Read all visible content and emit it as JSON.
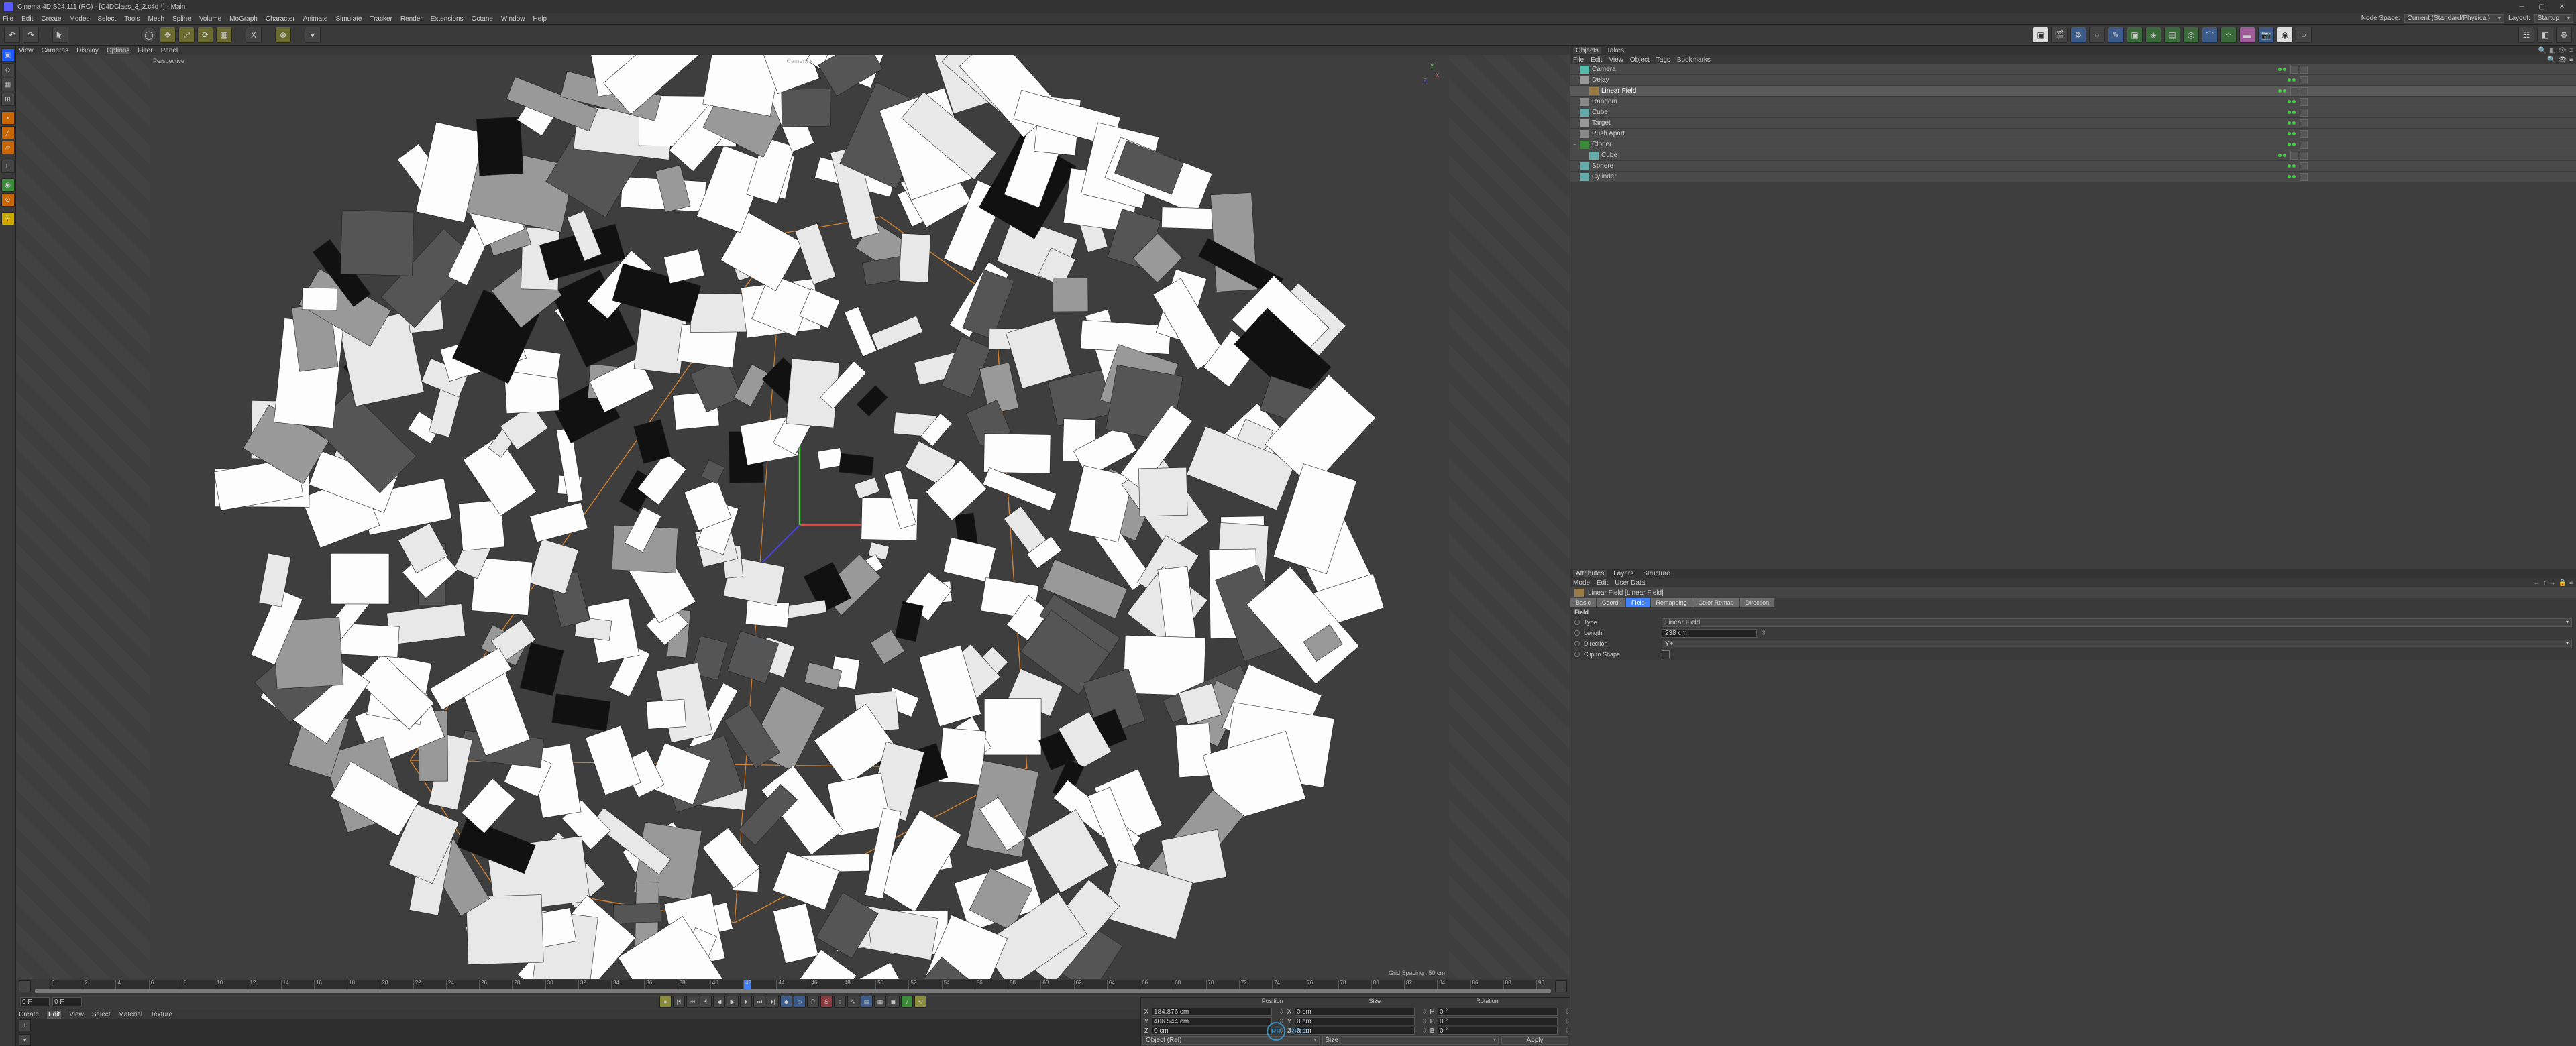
{
  "title": "Cinema 4D S24.111 (RC) - [C4DClass_3_2.c4d *] - Main",
  "menubar": [
    "File",
    "Edit",
    "Create",
    "Modes",
    "Select",
    "Tools",
    "Mesh",
    "Spline",
    "Volume",
    "MoGraph",
    "Character",
    "Animate",
    "Simulate",
    "Tracker",
    "Render",
    "Extensions",
    "Octane",
    "Window",
    "Help"
  ],
  "header_right": {
    "node_space_label": "Node Space:",
    "node_space_value": "Current (Standard/Physical)",
    "layout_label": "Layout:",
    "layout_value": "Startup"
  },
  "view_menu": [
    "View",
    "Cameras",
    "Display",
    "Options",
    "Filter",
    "Panel"
  ],
  "view_active_index": 3,
  "viewport": {
    "perspective": "Perspective",
    "camera": "Camera ▾",
    "grid": "Grid Spacing : 50 cm"
  },
  "timeline": {
    "start": "0 F",
    "end": "90 F",
    "range_start": "0 F",
    "range_end": "90 F",
    "cursor_frame": 42
  },
  "material_menu": [
    "Create",
    "Edit",
    "View",
    "Select",
    "Material",
    "Texture"
  ],
  "material_active_index": 1,
  "coords": {
    "headers": [
      "Position",
      "Size",
      "Rotation"
    ],
    "rows": [
      {
        "axis": "X",
        "pos": "184.876 cm",
        "size": "0 cm",
        "rotlbl": "H",
        "rot": "0 °"
      },
      {
        "axis": "Y",
        "pos": "406.544 cm",
        "size": "0 cm",
        "rotlbl": "P",
        "rot": "0 °"
      },
      {
        "axis": "Z",
        "pos": "0 cm",
        "size": "0 cm",
        "rotlbl": "B",
        "rot": "0 °"
      }
    ],
    "object_combo": "Object (Rel)",
    "size_combo": "Size",
    "apply": "Apply"
  },
  "objects_panel": {
    "tabs": [
      "Objects",
      "Takes"
    ],
    "menu": [
      "File",
      "Edit",
      "View",
      "Object",
      "Tags",
      "Bookmarks"
    ],
    "tree": [
      {
        "depth": 0,
        "exp": "",
        "icon": "cam",
        "name": "Camera",
        "sel": false,
        "tagcount": 2
      },
      {
        "depth": 0,
        "exp": "−",
        "icon": "delay",
        "name": "Delay",
        "sel": false,
        "tagcount": 1
      },
      {
        "depth": 1,
        "exp": "",
        "icon": "field",
        "name": "Linear Field",
        "sel": true,
        "tagcount": 2
      },
      {
        "depth": 0,
        "exp": "",
        "icon": "random",
        "name": "Random",
        "sel": false,
        "tagcount": 1
      },
      {
        "depth": 0,
        "exp": "",
        "icon": "cube",
        "name": "Cube",
        "sel": false,
        "tagcount": 1
      },
      {
        "depth": 0,
        "exp": "",
        "icon": "target",
        "name": "Target",
        "sel": false,
        "tagcount": 1
      },
      {
        "depth": 0,
        "exp": "",
        "icon": "random",
        "name": "Push Apart",
        "sel": false,
        "tagcount": 1
      },
      {
        "depth": 0,
        "exp": "−",
        "icon": "cloner",
        "name": "Cloner",
        "sel": false,
        "tagcount": 1
      },
      {
        "depth": 1,
        "exp": "",
        "icon": "cube",
        "name": "Cube",
        "sel": false,
        "tagcount": 2
      },
      {
        "depth": 0,
        "exp": "",
        "icon": "sphere",
        "name": "Sphere",
        "sel": false,
        "tagcount": 1
      },
      {
        "depth": 0,
        "exp": "",
        "icon": "cyl",
        "name": "Cylinder",
        "sel": false,
        "tagcount": 1
      }
    ]
  },
  "attributes": {
    "tabs": [
      "Attributes",
      "Layers",
      "Structure"
    ],
    "menu": [
      "Mode",
      "Edit",
      "User Data"
    ],
    "object_title": "Linear Field [Linear Field]",
    "attr_tabs": [
      "Basic",
      "Coord.",
      "Field",
      "Remapping",
      "Color Remap",
      "Direction"
    ],
    "attr_active": "Field",
    "section": "Field",
    "rows": [
      {
        "label": "Type",
        "kind": "combo",
        "value": "Linear Field"
      },
      {
        "label": "Length",
        "kind": "input",
        "value": "238 cm"
      },
      {
        "label": "Direction",
        "kind": "combo",
        "value": "Y+"
      },
      {
        "label": "Clip to Shape",
        "kind": "check",
        "value": false
      }
    ]
  },
  "watermark": "RRCG"
}
